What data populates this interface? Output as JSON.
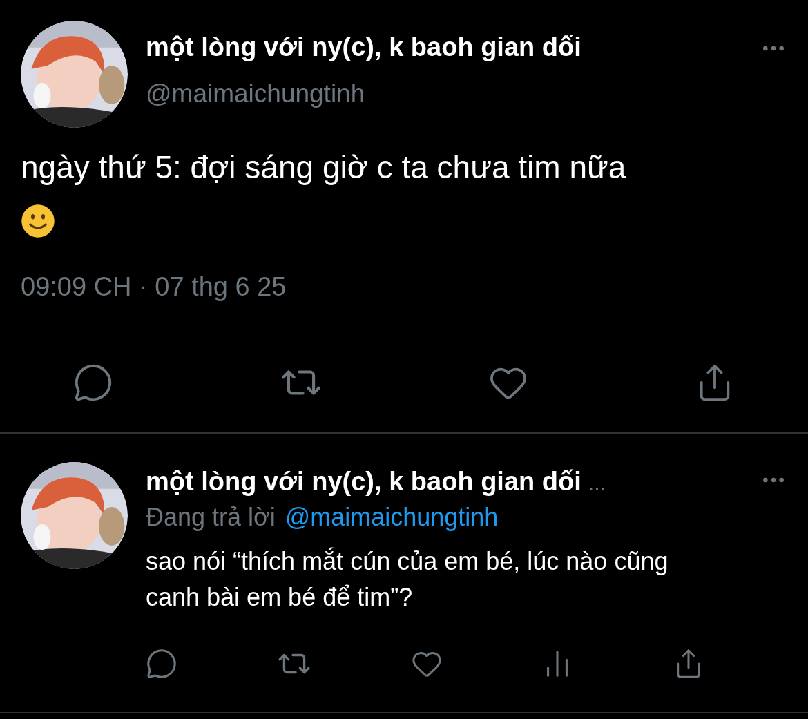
{
  "tweet": {
    "name": "một lòng với ny(c), k baoh gian dối",
    "handle": "@maimaichungtinh",
    "text": "ngày thứ 5: đợi sáng giờ c ta chưa tim nữa",
    "emoji": true,
    "time": "09:09 CH · 07 thg 6 25",
    "liked": false
  },
  "reply": {
    "name": "một lòng với ny(c), k baoh gian dối",
    "name_ellipsis": "...",
    "replying_label": "Đang trả lời",
    "replying_to": "@maimaichungtinh",
    "text": "sao nói “thích mắt cún của em bé, lúc nào cũng canh bài em bé để tim”?",
    "liked": false
  }
}
